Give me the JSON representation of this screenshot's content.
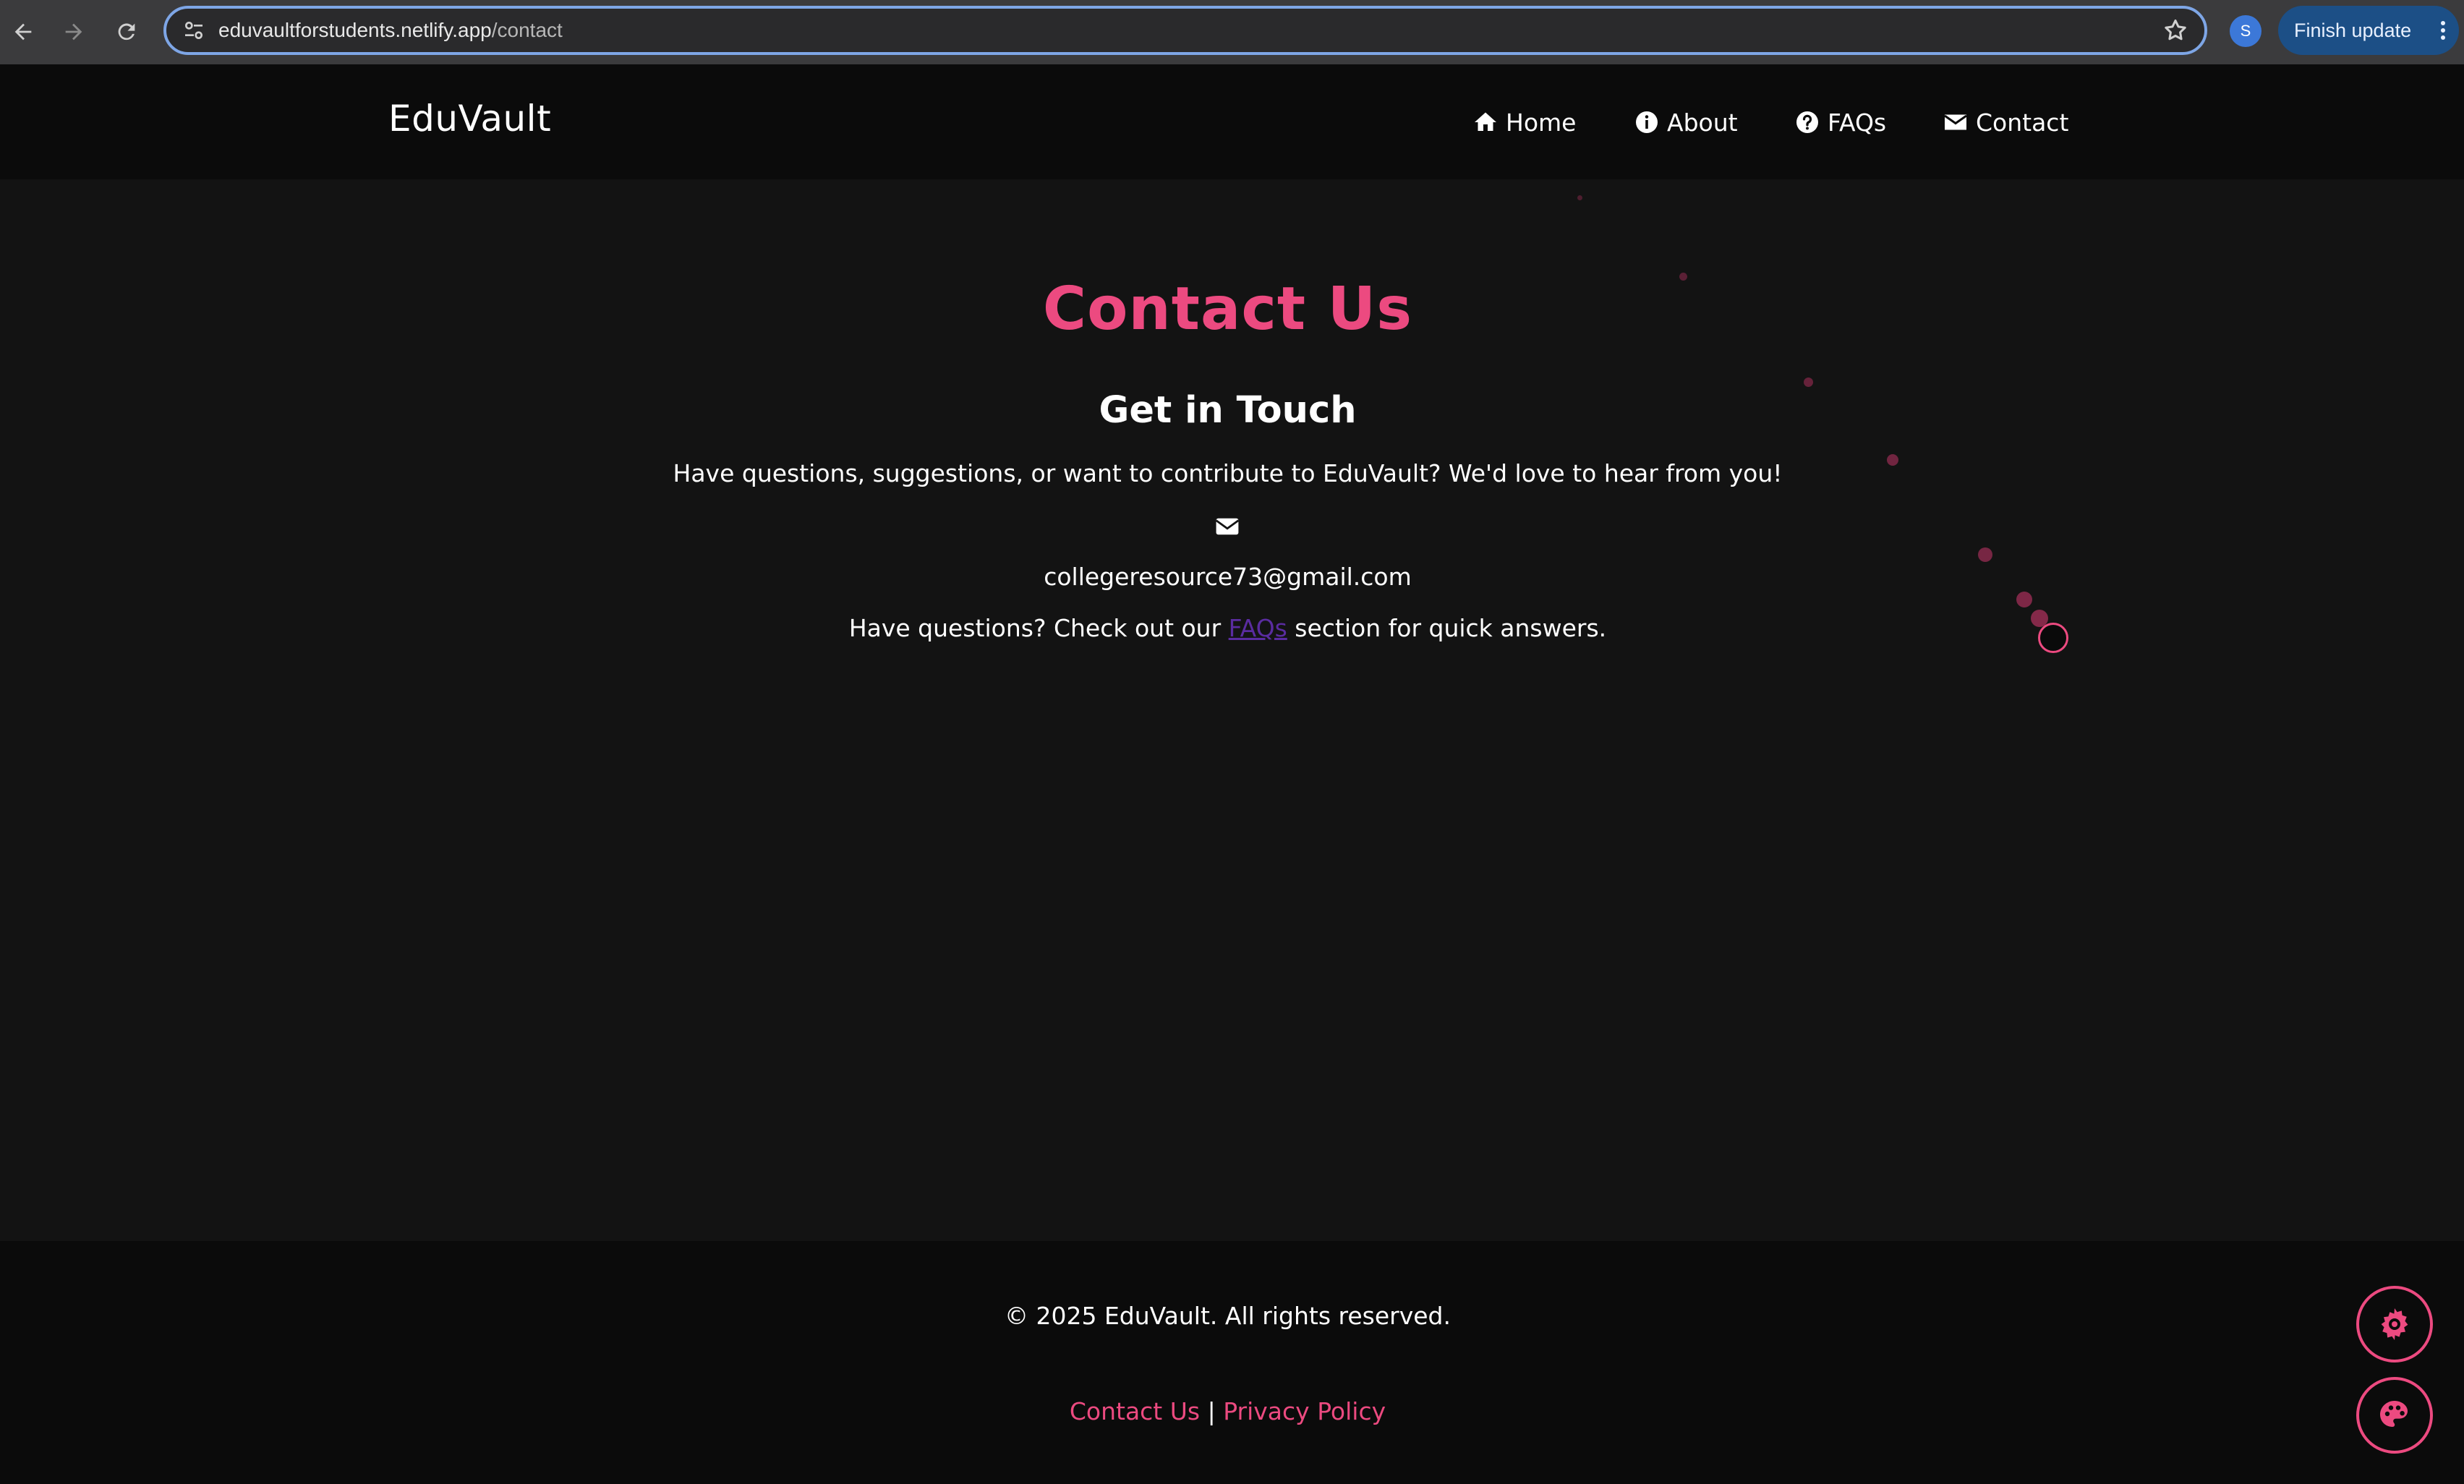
{
  "browser": {
    "url_host": "eduvaultforstudents.netlify.app",
    "url_path": "/contact",
    "profile_initial": "S",
    "update_label": "Finish update"
  },
  "header": {
    "brand": "EduVault",
    "nav": [
      {
        "label": "Home",
        "icon": "home-icon"
      },
      {
        "label": "About",
        "icon": "info-icon"
      },
      {
        "label": "FAQs",
        "icon": "question-icon"
      },
      {
        "label": "Contact",
        "icon": "envelope-icon"
      }
    ]
  },
  "main": {
    "title": "Contact Us",
    "subtitle": "Get in Touch",
    "intro": "Have questions, suggestions, or want to contribute to EduVault? We'd love to hear from you!",
    "email": "collegeresource73@gmail.com",
    "faq_prefix": "Have questions? Check out our",
    "faq_link": "FAQs",
    "faq_suffix": "section for quick answers."
  },
  "footer": {
    "copyright": "© 2025 EduVault. All rights reserved.",
    "contact_link": "Contact Us",
    "separator": "|",
    "privacy_link": "Privacy Policy"
  },
  "colors": {
    "accent": "#ec4a80",
    "background": "#131313",
    "header_bg": "#0b0b0b",
    "link_visited": "#5a2ca0"
  },
  "fabs": [
    {
      "name": "settings",
      "icon": "gear-icon"
    },
    {
      "name": "theme",
      "icon": "palette-icon"
    }
  ]
}
